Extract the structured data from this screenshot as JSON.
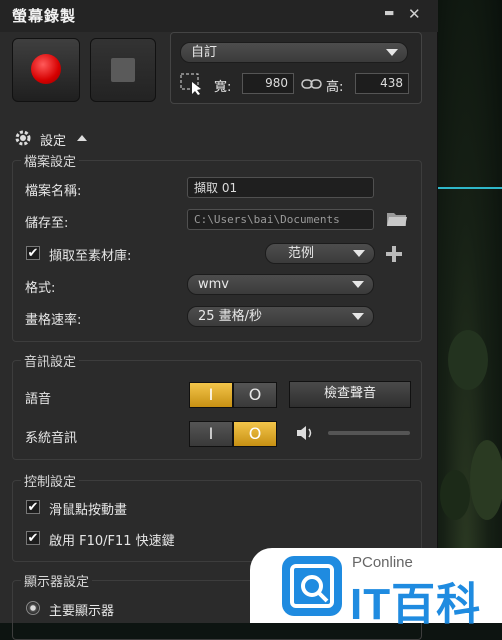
{
  "window": {
    "title": "螢幕錄製",
    "minimize": "▬",
    "close": "✕"
  },
  "region": {
    "preset": "自訂",
    "width_label": "寬:",
    "width_value": "980",
    "height_label": "高:",
    "height_value": "438"
  },
  "settings": {
    "label": "設定"
  },
  "file_settings": {
    "title": "檔案設定",
    "name_label": "檔案名稱:",
    "name_value": "擷取 01",
    "save_label": "儲存至:",
    "save_value": "C:\\Users\\bai\\Documents",
    "library_label": "擷取至素材庫:",
    "library_value": "范例",
    "format_label": "格式:",
    "format_value": "wmv",
    "framerate_label": "畫格速率:",
    "framerate_value": "25 畫格/秒"
  },
  "audio_settings": {
    "title": "音訊設定",
    "voice_label": "語音",
    "check_audio_button": "檢查聲音",
    "system_label": "系統音訊",
    "voice_on_symbol": "I",
    "voice_off_symbol": "O",
    "system_on_symbol": "I",
    "system_off_symbol": "O",
    "system_volume": 0.0
  },
  "control_settings": {
    "title": "控制設定",
    "mouse_click_label": "滑鼠點按動畫",
    "hotkey_label": "啟用 F10/F11 快速鍵"
  },
  "display_settings": {
    "title": "顯示器設定",
    "primary_label": "主要顯示器"
  },
  "watermark": {
    "small": "PConline",
    "big": "IT百科"
  },
  "colors": {
    "record_red": "#d60000",
    "toggle_on": "#e3ad2b",
    "accent_cyan": "#2fb7c9",
    "watermark_blue": "#1f8be0"
  }
}
